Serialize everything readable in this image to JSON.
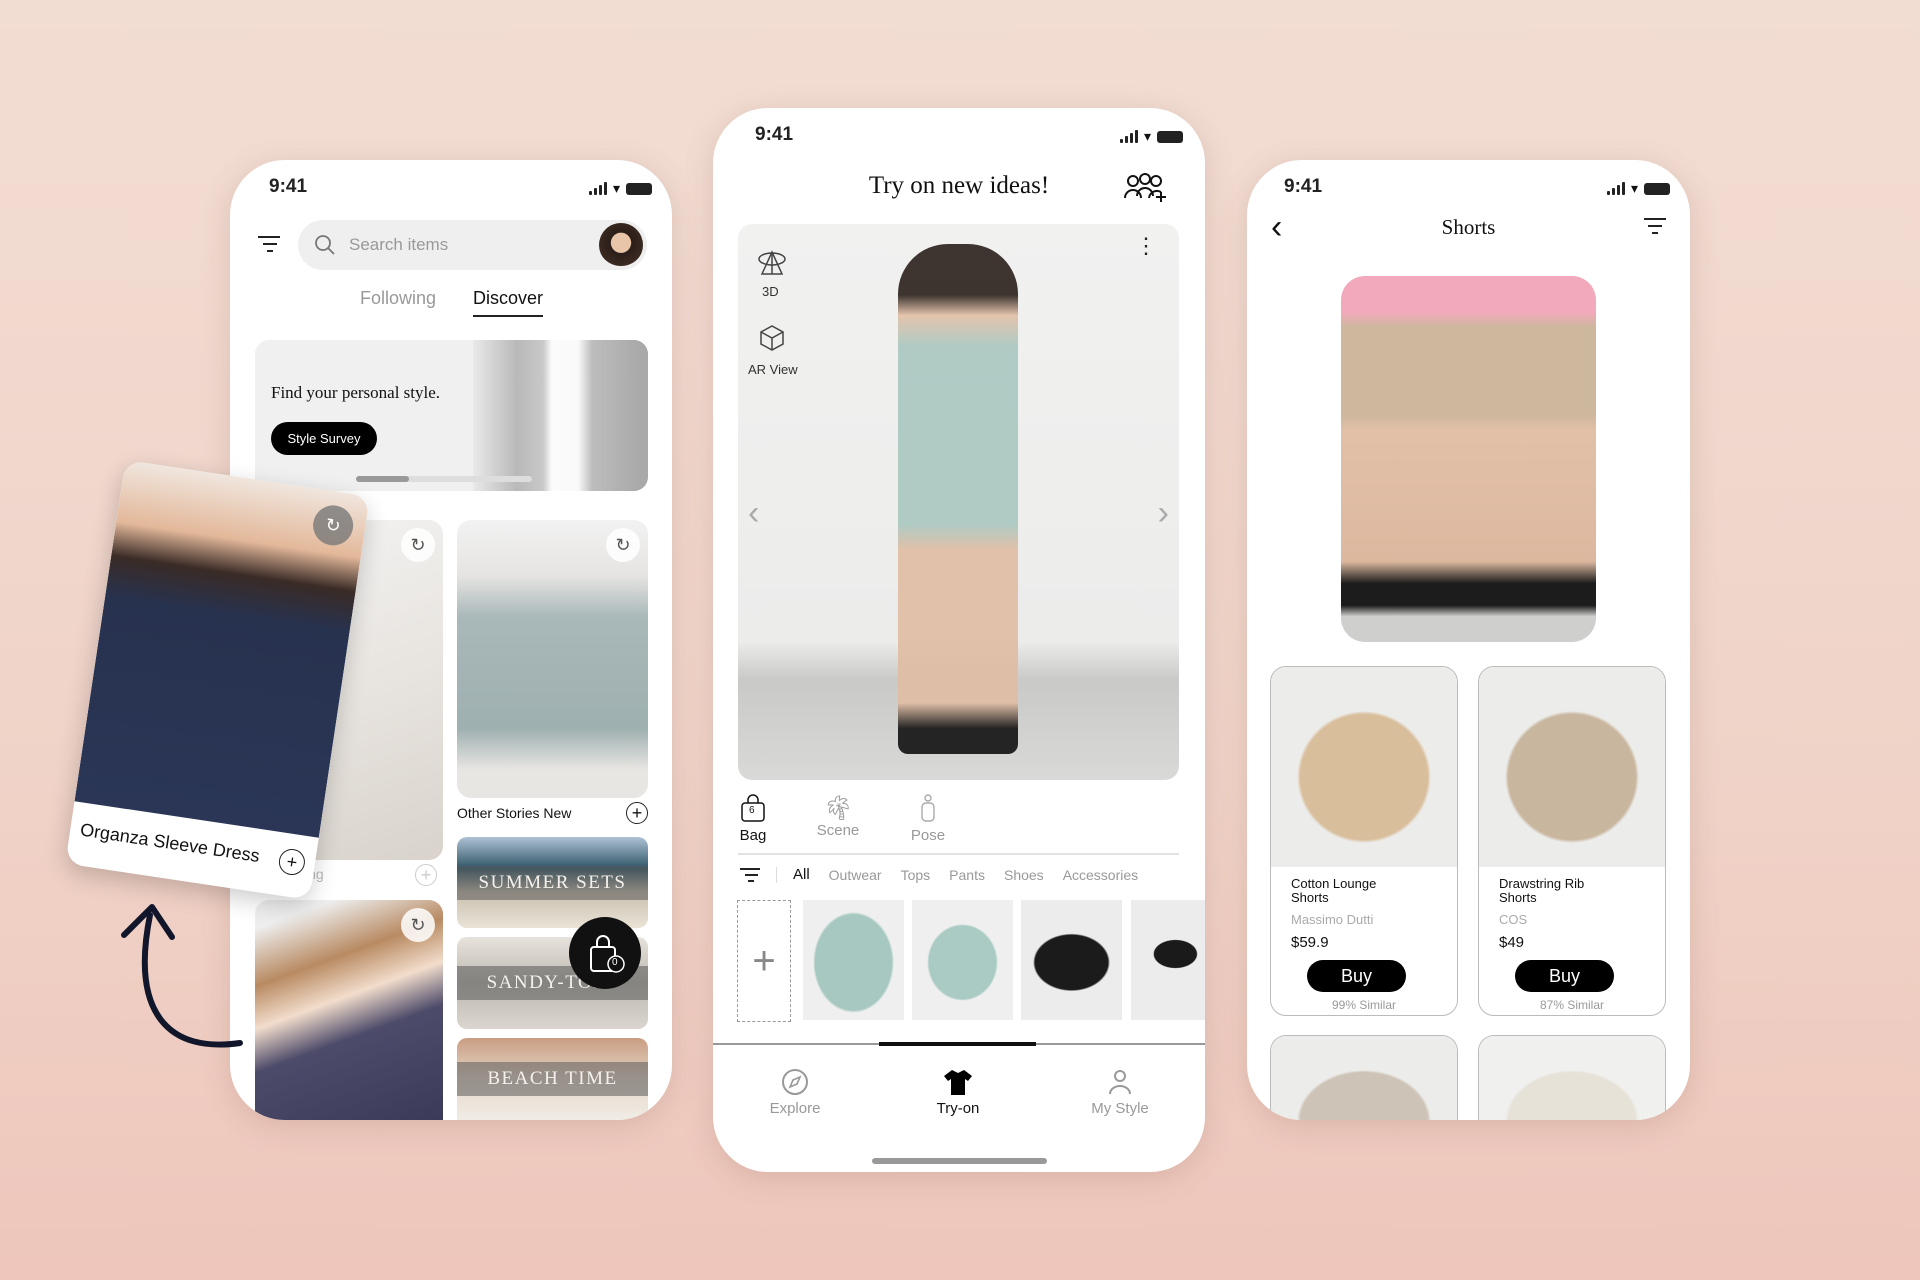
{
  "colors": {
    "background": "#f0d5ca",
    "accent": "#000000",
    "muted": "#999999"
  },
  "left_phone": {
    "status_time": "9:41",
    "search": {
      "placeholder": "Search items",
      "icon": "search-icon"
    },
    "tabs": [
      {
        "label": "Following",
        "active": false
      },
      {
        "label": "Discover",
        "active": true
      }
    ],
    "banner": {
      "text": "Find your personal style.",
      "button": "Style Survey",
      "progress": 0.3
    },
    "grid": {
      "left_label_partial": "ing",
      "right_label": "Other Stories New"
    },
    "collections": [
      "SUMMER SETS",
      "SANDY-TOES",
      "BEACH TIME"
    ],
    "bag_count": "0"
  },
  "floating_card": {
    "label": "Organza Sleeve Dress"
  },
  "middle_phone": {
    "status_time": "9:41",
    "title": "Try on new ideas!",
    "view_tools": [
      {
        "label": "3D",
        "icon": "3d-rotate-icon"
      },
      {
        "label": "AR View",
        "icon": "ar-cube-icon"
      }
    ],
    "toolbar": [
      {
        "label": "Bag",
        "badge": "6",
        "active": true
      },
      {
        "label": "Scene",
        "active": false
      },
      {
        "label": "Pose",
        "active": false
      }
    ],
    "categories": [
      {
        "label": "All",
        "active": true
      },
      {
        "label": "Outwear"
      },
      {
        "label": "Tops"
      },
      {
        "label": "Pants"
      },
      {
        "label": "Shoes"
      },
      {
        "label": "Accessories"
      }
    ],
    "thumbnails": [
      "sweater",
      "shorts",
      "sandals",
      "sunglasses"
    ],
    "nav": [
      {
        "label": "Explore",
        "icon": "compass-icon"
      },
      {
        "label": "Try-on",
        "icon": "tshirt-icon",
        "active": true
      },
      {
        "label": "My Style",
        "icon": "person-icon"
      }
    ]
  },
  "right_phone": {
    "status_time": "9:41",
    "title": "Shorts",
    "products": [
      {
        "name": "Cotton Lounge Shorts",
        "brand": "Massimo Dutti",
        "price": "$59.9",
        "button": "Buy",
        "similar": "99% Similar"
      },
      {
        "name": "Drawstring Rib Shorts",
        "brand": "COS",
        "price": "$49",
        "button": "Buy",
        "similar": "87% Similar"
      }
    ]
  }
}
